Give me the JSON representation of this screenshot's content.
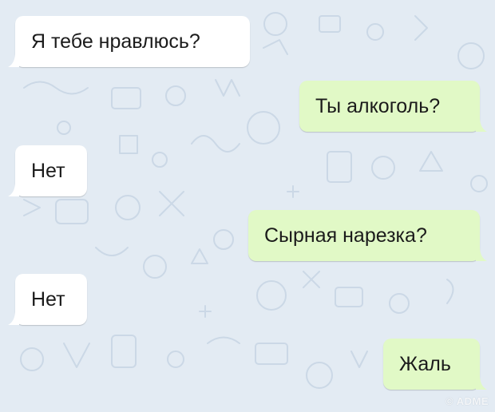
{
  "chat": {
    "messages": [
      {
        "direction": "incoming",
        "text": "Я тебе нравлюсь?"
      },
      {
        "direction": "outgoing",
        "text": "Ты алкоголь?"
      },
      {
        "direction": "incoming",
        "text": "Нет"
      },
      {
        "direction": "outgoing",
        "text": "Сырная нарезка?"
      },
      {
        "direction": "incoming",
        "text": "Нет"
      },
      {
        "direction": "outgoing",
        "text": "Жаль"
      }
    ]
  },
  "watermark": {
    "text": "© ADME"
  },
  "colors": {
    "background": "#e3ebf3",
    "incoming_bubble": "#ffffff",
    "outgoing_bubble": "#e1f9c6",
    "doodle": "#c9d7e6"
  }
}
